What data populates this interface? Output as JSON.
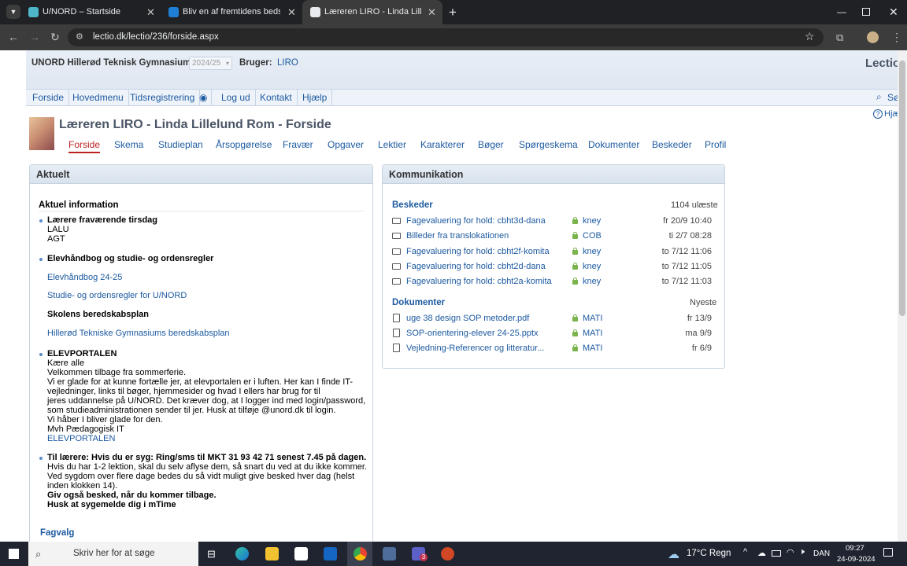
{
  "browser": {
    "tabs": [
      {
        "title": "U/NORD – Startside"
      },
      {
        "title": "Bliv en af fremtidens bedste stu"
      },
      {
        "title": "Læreren LIRO - Linda Lillelund R"
      }
    ],
    "url": "lectio.dk/lectio/236/forside.aspx"
  },
  "header": {
    "school": "UNORD Hillerød Teknisk Gymnasium",
    "year": "2024/25",
    "user_label": "Bruger:",
    "user": "LIRO",
    "logo": "Lectio"
  },
  "menu": [
    "Forside",
    "Hovedmenu",
    "Tidsregistrering",
    "Log ud",
    "Kontakt",
    "Hjælp"
  ],
  "search_label": "Sø",
  "help_label": "Hjæ",
  "page_title": "Læreren LIRO - Linda Lillelund Rom - Forside",
  "subtabs": [
    "Forside",
    "Skema",
    "Studieplan",
    "Årsopgørelse",
    "Fravær",
    "Opgaver",
    "Lektier",
    "Karakterer",
    "Bøger",
    "Spørgeskema",
    "Dokumenter",
    "Beskeder",
    "Profil"
  ],
  "aktuelt": {
    "title": "Aktuelt",
    "heading": "Aktuel information",
    "item1_title": "Lærere fraværende tirsdag",
    "item1_lines": [
      "LALU",
      "AGT"
    ],
    "item2_title": "Elevhåndbog og studie- og ordensregler",
    "item2_link1": "Elevhåndbog 24-25",
    "item2_link2": "Studie- og ordensregler for U/NORD",
    "item2_sub": "Skolens beredskabsplan",
    "item2_link3": "Hillerød Tekniske Gymnasiums beredskabsplan",
    "item3_title": "ELEVPORTALEN",
    "item3_lines": [
      "Kære alle",
      "Velkommen tilbage fra sommerferie.",
      "Vi er glade for at kunne fortælle jer, at elevportalen er i luften. Her kan I finde IT-",
      "vejledninger, links til bøger, hjemmesider og hvad I ellers har brug for til",
      "jeres  uddannelse på U/NORD. Det kræver dog, at I logger ind med login/password,",
      "som studieadministrationen sender til jer. Husk at tilføje @unord.dk til login.",
      "Vi håber I bliver glade for den.",
      "Mvh Pædagogisk IT"
    ],
    "item3_link": "ELEVPORTALEN",
    "item4_title": "Til lærere: Hvis du er syg: Ring/sms til MKT 31 93 42 71 senest 7.45 på dagen.",
    "item4_lines": [
      "Hvis du har 1-2 lektion, skal du selv aflyse dem, så snart du ved at du ikke kommer.",
      "Ved sygdom over flere dage bedes du så vidt muligt give besked hver dag (helst",
      "inden klokken 14)."
    ],
    "item4_bold1": "Giv også besked, når du kommer tilbage.",
    "item4_bold2": "Husk at sygemelde dig i mTime",
    "fagvalg": "Fagvalg"
  },
  "kommunikation": {
    "title": "Kommunikation",
    "beskeder_label": "Beskeder",
    "unread": "1104 ulæste",
    "messages": [
      {
        "subject": "Fagevaluering for hold: cbht3d-dana",
        "from": "kney",
        "date": "fr 20/9 10:40"
      },
      {
        "subject": "Billeder fra translokationen",
        "from": "COB",
        "date": "ti 2/7 08:28"
      },
      {
        "subject": "Fagevaluering for hold: cbht2f-komita",
        "from": "kney",
        "date": "to 7/12 11:06"
      },
      {
        "subject": "Fagevaluering for hold: cbht2d-dana",
        "from": "kney",
        "date": "to 7/12 11:05"
      },
      {
        "subject": "Fagevaluering for hold: cbht2a-komita",
        "from": "kney",
        "date": "to 7/12 11:03"
      }
    ],
    "dokumenter_label": "Dokumenter",
    "newest": "Nyeste",
    "documents": [
      {
        "name": "uge 38 design SOP metoder.pdf",
        "from": "MATI",
        "date": "fr 13/9"
      },
      {
        "name": "SOP-orientering-elever 24-25.pptx",
        "from": "MATI",
        "date": "ma 9/9"
      },
      {
        "name": "Vejledning-Referencer og litteratur...",
        "from": "MATI",
        "date": "fr 6/9"
      }
    ]
  },
  "taskbar": {
    "search_placeholder": "Skriv her for at søge",
    "weather": "17°C Regn",
    "lang": "DAN",
    "time": "09:27",
    "date": "24-09-2024",
    "teams_badge": "3"
  }
}
